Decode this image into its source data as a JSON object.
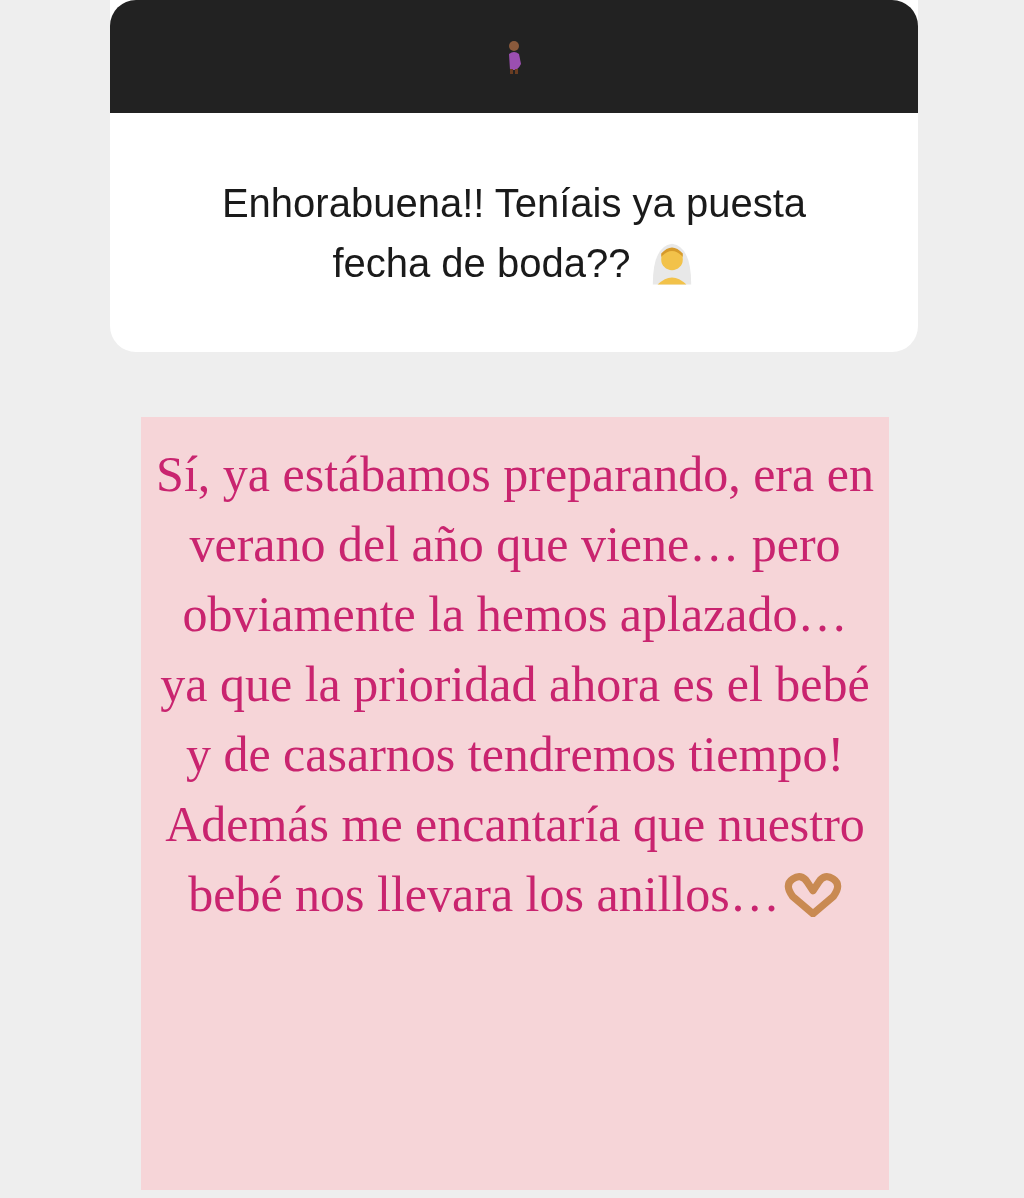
{
  "question": {
    "text": "Enhorabuena!! Teníais ya puesta fecha de boda??"
  },
  "answer": {
    "paragraphs": [
      "Sí, ya estábamos preparando, era en verano del año que viene… pero obviamente la hemos aplazado… ya que la prioridad ahora es el bebé y de casarnos tendremos tiempo!",
      "Además me encantaría que nuestro bebé nos llevara los anillos…"
    ]
  }
}
